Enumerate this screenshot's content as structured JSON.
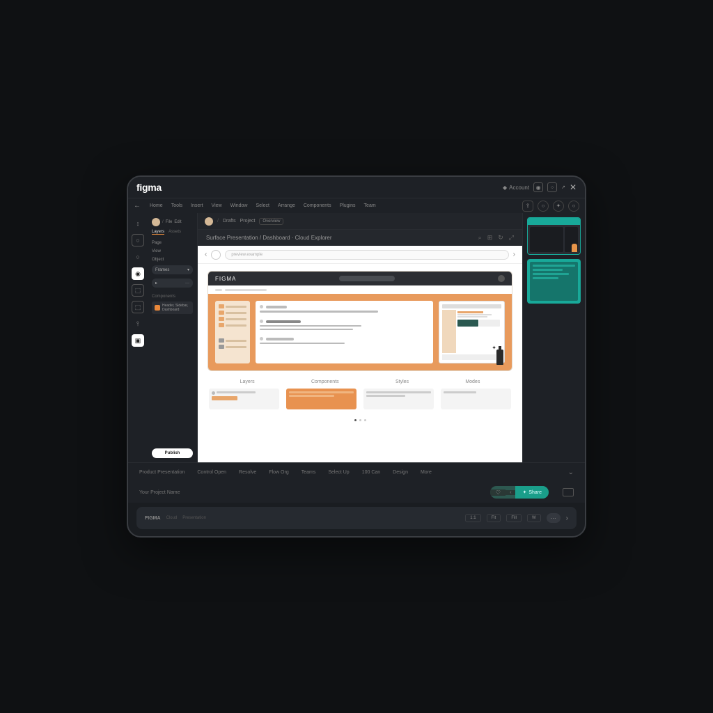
{
  "titlebar": {
    "logo": "figma",
    "account_label": "Account",
    "close": "✕"
  },
  "menubar": {
    "items": [
      "Home",
      "Tools",
      "Insert",
      "View",
      "Window",
      "Select",
      "Arrange",
      "Components",
      "Plugins",
      "Team"
    ]
  },
  "toolbar": {
    "tools": [
      "↕",
      "○",
      "○",
      "◉",
      "⬚",
      "⬚",
      "⫯",
      "▣"
    ]
  },
  "left_panel": {
    "tabs": [
      "Layers",
      "Assets"
    ],
    "breadcrumb_items": [
      "File",
      "Edit"
    ],
    "rows": [
      "Page",
      "View",
      "Object"
    ],
    "selector": "Frames",
    "section_label": "Components",
    "items": [
      "Header, Sidebar, Dashboard"
    ],
    "cta": "Publish"
  },
  "canvas_header": {
    "crumbs": [
      "Drafts",
      "Project",
      "Overview"
    ],
    "title": "Surface Presentation / Dashboard · Cloud Explorer"
  },
  "browser": {
    "url_placeholder": "preview.example",
    "mock_title": "FIGMA",
    "features": [
      "Layers",
      "Components",
      "Styles",
      "Modes"
    ]
  },
  "right_panel": {
    "thumbs": 2
  },
  "bottom_tabs": {
    "items": [
      "Product Presentation",
      "Control Open",
      "Resolve",
      "Flow Org",
      "Teams",
      "Select Up",
      "100 Can",
      "Design",
      "More"
    ]
  },
  "action_row": {
    "label": "Your Project Name",
    "share": "Share"
  },
  "footer": {
    "brand": "FIGMA",
    "sub1": "Cloud",
    "sub2": "Presentation",
    "chips": [
      "1:1",
      "Fit",
      "Fill",
      "W"
    ]
  }
}
